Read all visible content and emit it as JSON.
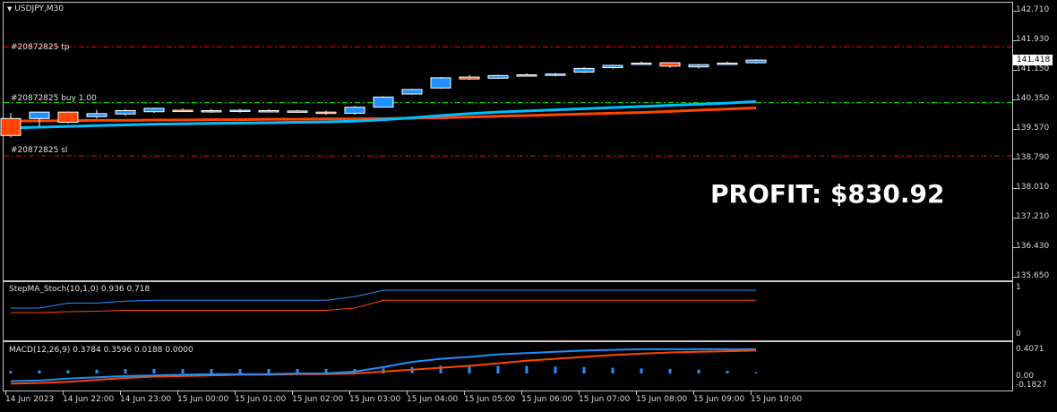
{
  "symbol_label": "USDJPY,M30",
  "current_price": "141.418",
  "profit_text": "PROFIT: $830.92",
  "order_labels": {
    "tp": "#20872825 tp",
    "buy": "#20872825 buy 1.00",
    "sl": "#20872825 sl"
  },
  "price_axis": [
    "142.710",
    "141.930",
    "141.150",
    "140.350",
    "139.570",
    "138.790",
    "138.010",
    "137.210",
    "136.430",
    "135.650"
  ],
  "stoch": {
    "label": "StepMA_Stoch(10,1,0) 0.936 0.718",
    "axis": [
      "1",
      "0"
    ]
  },
  "macd": {
    "label": "MACD(12,26,9) 0.3784 0.3596 0.0188 0.0000",
    "axis": [
      "0.4071",
      "0.00",
      "-0.1827"
    ]
  },
  "time_axis": [
    "14 Jun 2023",
    "14 Jun 22:00",
    "14 Jun 23:00",
    "15 Jun 00:00",
    "15 Jun 01:00",
    "15 Jun 02:00",
    "15 Jun 03:00",
    "15 Jun 04:00",
    "15 Jun 05:00",
    "15 Jun 06:00",
    "15 Jun 07:00",
    "15 Jun 08:00",
    "15 Jun 09:00",
    "15 Jun 10:00"
  ],
  "colors": {
    "bull": "#1e90ff",
    "bear": "#ff4500",
    "ma_fast": "#00bfff",
    "ma_slow": "#ff4500",
    "tp_sl_line": "#ff0000",
    "buy_line": "#00ff00"
  },
  "chart_data": {
    "type": "candlestick",
    "candles": [
      {
        "o": 139.85,
        "h": 140.0,
        "l": 139.35,
        "c": 139.4
      },
      {
        "o": 139.85,
        "h": 139.97,
        "l": 139.64,
        "c": 140.02
      },
      {
        "o": 140.02,
        "h": 140.04,
        "l": 139.72,
        "c": 139.75
      },
      {
        "o": 139.9,
        "h": 140.08,
        "l": 139.85,
        "c": 139.98
      },
      {
        "o": 139.97,
        "h": 140.1,
        "l": 139.92,
        "c": 140.06
      },
      {
        "o": 140.03,
        "h": 140.14,
        "l": 140.0,
        "c": 140.12
      },
      {
        "o": 140.07,
        "h": 140.12,
        "l": 140.02,
        "c": 140.05
      },
      {
        "o": 140.06,
        "h": 140.1,
        "l": 140.0,
        "c": 140.04
      },
      {
        "o": 140.05,
        "h": 140.1,
        "l": 140.01,
        "c": 140.07
      },
      {
        "o": 140.06,
        "h": 140.1,
        "l": 140.01,
        "c": 140.04
      },
      {
        "o": 140.05,
        "h": 140.08,
        "l": 140.0,
        "c": 140.02
      },
      {
        "o": 140.02,
        "h": 140.06,
        "l": 139.95,
        "c": 139.99
      },
      {
        "o": 139.99,
        "h": 140.18,
        "l": 139.95,
        "c": 140.15
      },
      {
        "o": 140.15,
        "h": 140.44,
        "l": 140.14,
        "c": 140.42
      },
      {
        "o": 140.5,
        "h": 140.64,
        "l": 140.48,
        "c": 140.62
      },
      {
        "o": 140.66,
        "h": 140.95,
        "l": 140.64,
        "c": 140.93
      },
      {
        "o": 140.95,
        "h": 141.0,
        "l": 140.88,
        "c": 140.9
      },
      {
        "o": 140.92,
        "h": 141.01,
        "l": 140.9,
        "c": 140.99
      },
      {
        "o": 141.0,
        "h": 141.05,
        "l": 140.97,
        "c": 141.01
      },
      {
        "o": 141.0,
        "h": 141.06,
        "l": 140.97,
        "c": 141.03
      },
      {
        "o": 141.08,
        "h": 141.21,
        "l": 141.06,
        "c": 141.18
      },
      {
        "o": 141.2,
        "h": 141.28,
        "l": 141.17,
        "c": 141.26
      },
      {
        "o": 141.3,
        "h": 141.36,
        "l": 141.28,
        "c": 141.32
      },
      {
        "o": 141.33,
        "h": 141.34,
        "l": 141.2,
        "c": 141.24
      },
      {
        "o": 141.22,
        "h": 141.3,
        "l": 141.18,
        "c": 141.28
      },
      {
        "o": 141.3,
        "h": 141.36,
        "l": 141.28,
        "c": 141.32
      },
      {
        "o": 141.33,
        "h": 141.42,
        "l": 141.31,
        "c": 141.4
      }
    ],
    "ma_fast": [
      139.6,
      139.62,
      139.64,
      139.66,
      139.68,
      139.7,
      139.71,
      139.72,
      139.73,
      139.74,
      139.75,
      139.76,
      139.78,
      139.82,
      139.87,
      139.93,
      139.98,
      140.02,
      140.05,
      140.08,
      140.11,
      140.14,
      140.17,
      140.2,
      140.23,
      140.26,
      140.3
    ],
    "ma_slow": [
      139.78,
      139.79,
      139.79,
      139.8,
      139.8,
      139.81,
      139.81,
      139.82,
      139.82,
      139.83,
      139.83,
      139.84,
      139.84,
      139.85,
      139.86,
      139.87,
      139.89,
      139.91,
      139.93,
      139.95,
      139.97,
      139.99,
      140.01,
      140.04,
      140.07,
      140.1,
      140.13
    ],
    "tp": 141.75,
    "entry": 140.27,
    "sl": 138.86,
    "ylim": [
      135.65,
      142.71
    ],
    "stoch_fast": [
      0.55,
      0.55,
      0.66,
      0.66,
      0.7,
      0.72,
      0.72,
      0.72,
      0.72,
      0.72,
      0.72,
      0.72,
      0.8,
      0.94,
      0.94,
      0.94,
      0.94,
      0.94,
      0.94,
      0.94,
      0.94,
      0.94,
      0.94,
      0.94,
      0.94,
      0.94,
      0.94
    ],
    "stoch_slow": [
      0.45,
      0.45,
      0.47,
      0.48,
      0.5,
      0.5,
      0.5,
      0.5,
      0.5,
      0.5,
      0.5,
      0.5,
      0.55,
      0.72,
      0.72,
      0.72,
      0.72,
      0.72,
      0.72,
      0.72,
      0.72,
      0.72,
      0.72,
      0.72,
      0.72,
      0.72,
      0.72
    ],
    "macd_hist": [
      0.04,
      0.05,
      0.05,
      0.06,
      0.07,
      0.07,
      0.07,
      0.07,
      0.07,
      0.07,
      0.07,
      0.07,
      0.07,
      0.08,
      0.1,
      0.12,
      0.12,
      0.12,
      0.12,
      0.11,
      0.1,
      0.09,
      0.08,
      0.07,
      0.06,
      0.04,
      0.02
    ],
    "macd_main": [
      -0.12,
      -0.11,
      -0.08,
      -0.06,
      -0.04,
      -0.03,
      -0.02,
      -0.01,
      -0.01,
      -0.01,
      0.0,
      0.0,
      0.03,
      0.1,
      0.18,
      0.23,
      0.26,
      0.3,
      0.32,
      0.34,
      0.36,
      0.37,
      0.38,
      0.38,
      0.38,
      0.38,
      0.38
    ],
    "macd_signal": [
      -0.16,
      -0.15,
      -0.13,
      -0.1,
      -0.07,
      -0.05,
      -0.04,
      -0.03,
      -0.02,
      -0.02,
      -0.01,
      -0.01,
      0.0,
      0.03,
      0.06,
      0.09,
      0.12,
      0.16,
      0.2,
      0.23,
      0.26,
      0.29,
      0.31,
      0.33,
      0.34,
      0.35,
      0.36
    ]
  }
}
